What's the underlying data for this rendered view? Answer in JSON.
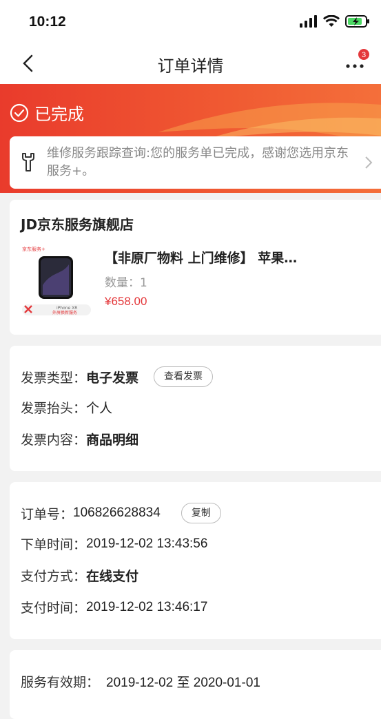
{
  "status_bar": {
    "time": "10:12"
  },
  "nav": {
    "title": "订单详情",
    "badge_count": "3"
  },
  "hero": {
    "status": "已完成",
    "accent_color": "#e93b2c"
  },
  "service": {
    "text": "维修服务跟踪查询:您的服务单已完成，感谢您选用京东服务+。"
  },
  "shop": {
    "name": "JD京东服务旗舰店",
    "product": {
      "title": "【非原厂物料 上门维修】 苹果…",
      "qty_label": "数量：",
      "qty": "1",
      "price": "¥658.00",
      "thumb_brand": "京东服务+",
      "thumb_model": "iPhone XR",
      "thumb_service": "外屏换新服务"
    }
  },
  "invoice": {
    "type_label": "发票类型：",
    "type_value": "电子发票",
    "view_button": "查看发票",
    "header_label": "发票抬头：",
    "header_value": "个人",
    "content_label": "发票内容：",
    "content_value": "商品明细"
  },
  "order": {
    "number_label": "订单号：",
    "number_value": "106826628834",
    "copy_button": "复制",
    "time_label": "下单时间：",
    "time_value": "2019-12-02 13:43:56",
    "pay_method_label": "支付方式：",
    "pay_method_value": "在线支付",
    "pay_time_label": "支付时间：",
    "pay_time_value": "2019-12-02 13:46:17"
  },
  "validity": {
    "label": "服务有效期：",
    "value": "2019-12-02 至 2020-01-01"
  }
}
